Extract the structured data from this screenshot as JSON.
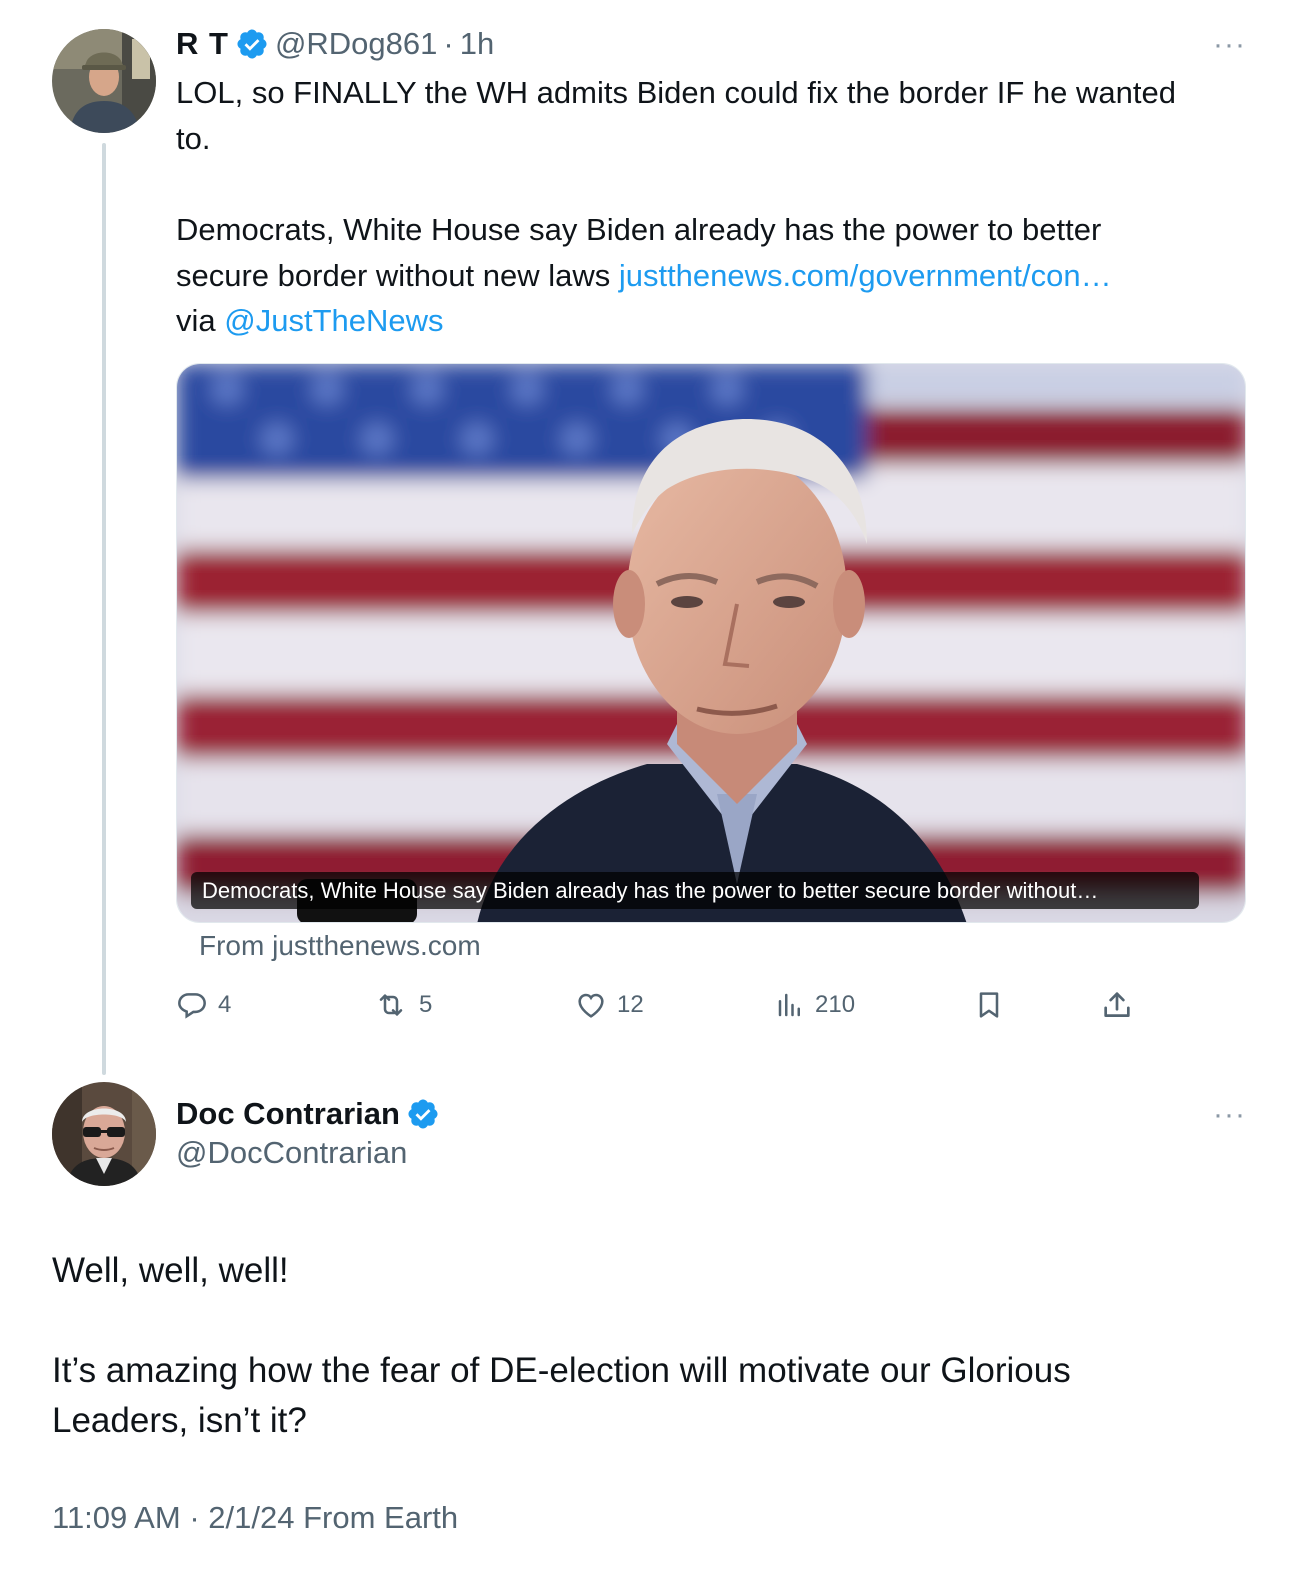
{
  "colors": {
    "text": "#0f1419",
    "secondary": "#536471",
    "link": "#1d9bf0",
    "verified": "#1d9bf0",
    "thread_line": "#cfd9de"
  },
  "tweet1": {
    "avatar_icon": "user-avatar-photo",
    "display_name": "R T",
    "verified_icon": "verified-badge-icon",
    "handle": "@RDog861",
    "separator": "·",
    "time": "1h",
    "more_icon": "more-options-icon",
    "more_label": "···",
    "text_line1": "LOL, so FINALLY the WH admits Biden could fix the border IF he wanted",
    "text_line2": "to.",
    "text_line3": "Democrats, White House say Biden already has the power to better",
    "text_line4_prefix": "secure border without new laws ",
    "text_line4_link": "justthenews.com/government/con…",
    "text_line5_prefix": "via ",
    "text_line5_mention": "@JustTheNews",
    "card": {
      "image_description_icon": "news-photo",
      "caption": "Democrats, White House say Biden already has the power to better secure border without…",
      "source": "From justthenews.com"
    },
    "actions": {
      "reply_icon": "reply-icon",
      "reply_count": "4",
      "retweet_icon": "retweet-icon",
      "retweet_count": "5",
      "like_icon": "like-icon",
      "like_count": "12",
      "views_icon": "views-icon",
      "views_count": "210",
      "bookmark_icon": "bookmark-icon",
      "share_icon": "share-icon"
    }
  },
  "tweet2": {
    "avatar_icon": "user-avatar-photo",
    "display_name": "Doc Contrarian",
    "verified_icon": "verified-badge-icon",
    "handle": "@DocContrarian",
    "more_label": "···",
    "text_line1": "Well, well, well!",
    "text_line2": "It’s amazing how the fear of DE-election will motivate our Glorious",
    "text_line3": "Leaders, isn’t it?",
    "time": "11:09 AM",
    "separator": "·",
    "date": "2/1/24",
    "source": "From Earth"
  }
}
